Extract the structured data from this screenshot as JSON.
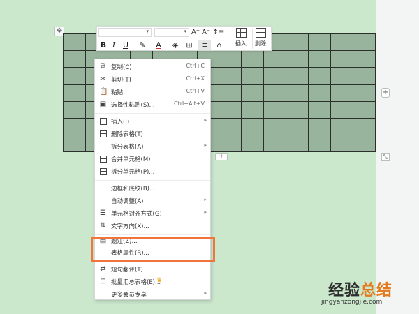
{
  "colors": {
    "page_bg": "#c9e6cb",
    "table_fill": "#99b49d",
    "highlight": "#f0743b",
    "watermark_accent": "#e37a1d"
  },
  "table": {
    "rows": 7,
    "cols": 14
  },
  "handles": {
    "move": "✥",
    "add_col": "+",
    "add_row": "+",
    "resize": "⤡"
  },
  "toolbar": {
    "grow_font": "A⁺",
    "shrink_font": "A⁻",
    "line_spacing": "↕≡",
    "bold": "B",
    "italic": "I",
    "underline": "U",
    "highlight_color": "✎",
    "font_color": "A",
    "shading": "◈",
    "borders": "⊞",
    "align": "≡",
    "clear": "⌂",
    "insert_label": "插入",
    "delete_label": "删除"
  },
  "menu": {
    "items": [
      {
        "label": "复制(C)",
        "shortcut": "Ctrl+C",
        "icon": "copy-icon"
      },
      {
        "label": "剪切(T)",
        "shortcut": "Ctrl+X",
        "icon": "scissors-icon"
      },
      {
        "label": "粘贴",
        "shortcut": "Ctrl+V",
        "icon": "paste-icon"
      },
      {
        "label": "选择性粘贴(S)...",
        "shortcut": "Ctrl+Alt+V",
        "icon": "paste-special-icon"
      },
      {
        "label": "插入(I)",
        "icon": "table-insert-icon",
        "submenu": true
      },
      {
        "label": "删除表格(T)",
        "icon": "table-delete-icon"
      },
      {
        "label": "拆分表格(A)",
        "submenu": true
      },
      {
        "label": "合并单元格(M)",
        "icon": "merge-cells-icon"
      },
      {
        "label": "拆分单元格(P)...",
        "icon": "split-cells-icon"
      },
      {
        "label": "边框和底纹(B)..."
      },
      {
        "label": "自动调整(A)",
        "submenu": true
      },
      {
        "label": "单元格对齐方式(G)",
        "icon": "cell-align-icon",
        "submenu": true
      },
      {
        "label": "文字方向(X)...",
        "icon": "text-direction-icon"
      },
      {
        "label": "题注(Z)...",
        "icon": "caption-icon"
      },
      {
        "label": "表格属性(R)..."
      },
      {
        "label": "短句翻译(T)",
        "icon": "translate-icon"
      },
      {
        "label": "批量汇总表格(E)...",
        "icon": "batch-summary-icon",
        "crown": "♛"
      },
      {
        "label": "更多会员专享",
        "submenu": true
      }
    ],
    "submenu_glyph": "▸"
  },
  "watermark": {
    "main_a": "经验",
    "main_b": "总结",
    "sub": "jingyanzongjie.com"
  }
}
